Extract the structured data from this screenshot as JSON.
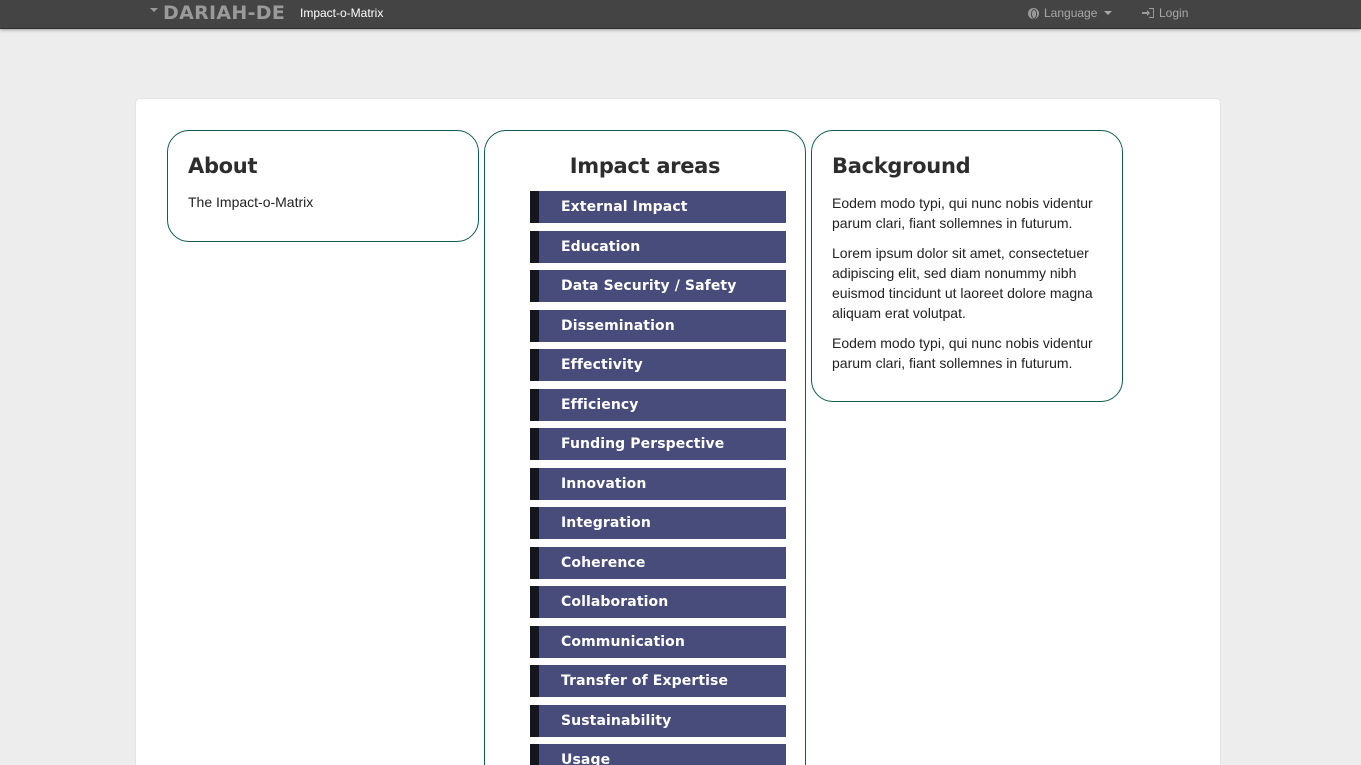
{
  "navbar": {
    "brand": "DARIAH-DE",
    "app_title": "Impact-o-Matrix",
    "language_label": "Language",
    "login_label": "Login"
  },
  "about": {
    "title": "About",
    "text": "The Impact-o-Matrix"
  },
  "impact": {
    "title": "Impact areas",
    "items": [
      "External Impact",
      "Education",
      "Data Security / Safety",
      "Dissemination",
      "Effectivity",
      "Efficiency",
      "Funding Perspective",
      "Innovation",
      "Integration",
      "Coherence",
      "Collaboration",
      "Communication",
      "Transfer of Expertise",
      "Sustainability",
      "Usage"
    ]
  },
  "background": {
    "title": "Background",
    "paragraphs": [
      "Eodem modo typi, qui nunc nobis videntur parum clari, fiant sollemnes in futurum.",
      "Lorem ipsum dolor sit amet, consectetuer adipiscing elit, sed diam nonummy nibh euismod tincidunt ut laoreet dolore magna aliquam erat volutpat.",
      "Eodem modo typi, qui nunc nobis videntur parum clari, fiant sollemnes in futurum."
    ]
  },
  "colors": {
    "navbar_bg": "#444444",
    "card_border": "#0f5b52",
    "area_bg": "#484c7a",
    "area_stripe": "#16161f"
  }
}
